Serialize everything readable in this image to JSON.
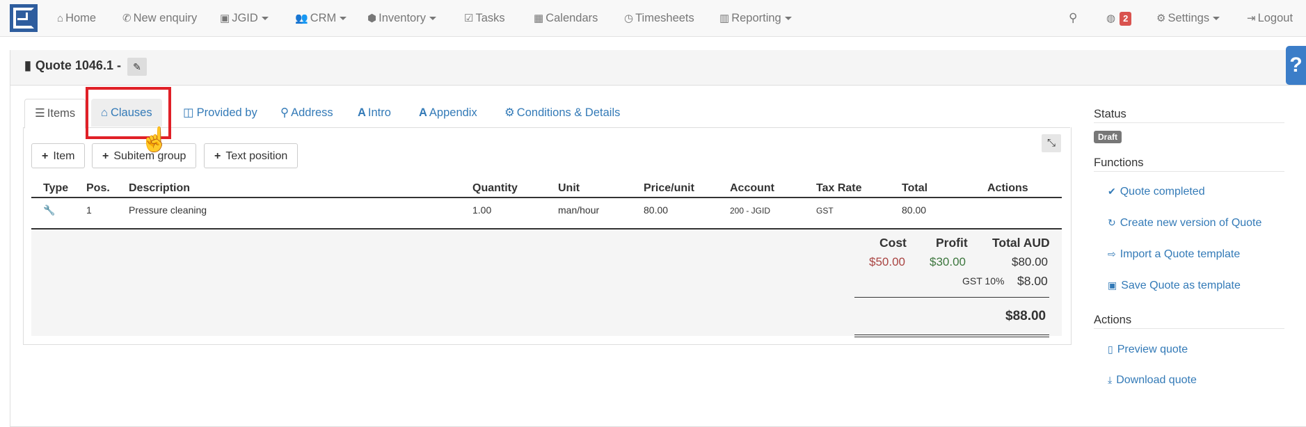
{
  "nav": {
    "home": "Home",
    "new_enquiry": "New enquiry",
    "jgid": "JGID",
    "crm": "CRM",
    "inventory": "Inventory",
    "tasks": "Tasks",
    "calendars": "Calendars",
    "timesheets": "Timesheets",
    "reporting": "Reporting",
    "notifications_count": "2",
    "settings": "Settings",
    "logout": "Logout"
  },
  "header": {
    "title": "Quote 1046.1 -",
    "help": "?"
  },
  "tabs": [
    {
      "label": "Items",
      "icon": "list-icon"
    },
    {
      "label": "Clauses",
      "icon": "bank-icon"
    },
    {
      "label": "Provided by",
      "icon": "columns-icon"
    },
    {
      "label": "Address",
      "icon": "map-marker-icon"
    },
    {
      "label": "Intro",
      "icon": "font-icon"
    },
    {
      "label": "Appendix",
      "icon": "font-icon"
    },
    {
      "label": "Conditions & Details",
      "icon": "cogs-icon"
    }
  ],
  "buttons": {
    "item": "Item",
    "subitem_group": "Subitem group",
    "text_position": "Text position"
  },
  "table": {
    "headers": [
      "Type",
      "Pos.",
      "Description",
      "Quantity",
      "Unit",
      "Price/unit",
      "Account",
      "Tax Rate",
      "Total",
      "Actions"
    ],
    "rows": [
      {
        "pos": "1",
        "description": "Pressure cleaning",
        "quantity": "1.00",
        "unit": "man/hour",
        "price": "80.00",
        "account": "200 - JGID",
        "tax": "GST",
        "total": "80.00"
      }
    ]
  },
  "summary": {
    "cost_label": "Cost",
    "profit_label": "Profit",
    "total_label": "Total AUD",
    "cost": "$50.00",
    "profit": "$30.00",
    "total": "$80.00",
    "gst_label": "GST 10%",
    "gst": "$8.00",
    "grand_total": "$88.00",
    "colors": {
      "cost": "#a94442",
      "profit": "#3c763d"
    }
  },
  "sidebar": {
    "status_label": "Status",
    "status_badge": "Draft",
    "functions_label": "Functions",
    "functions": [
      "Quote completed",
      "Create new version of Quote",
      "Import a Quote template",
      "Save Quote as template"
    ],
    "actions_label": "Actions",
    "actions": [
      "Preview quote",
      "Download quote"
    ]
  }
}
